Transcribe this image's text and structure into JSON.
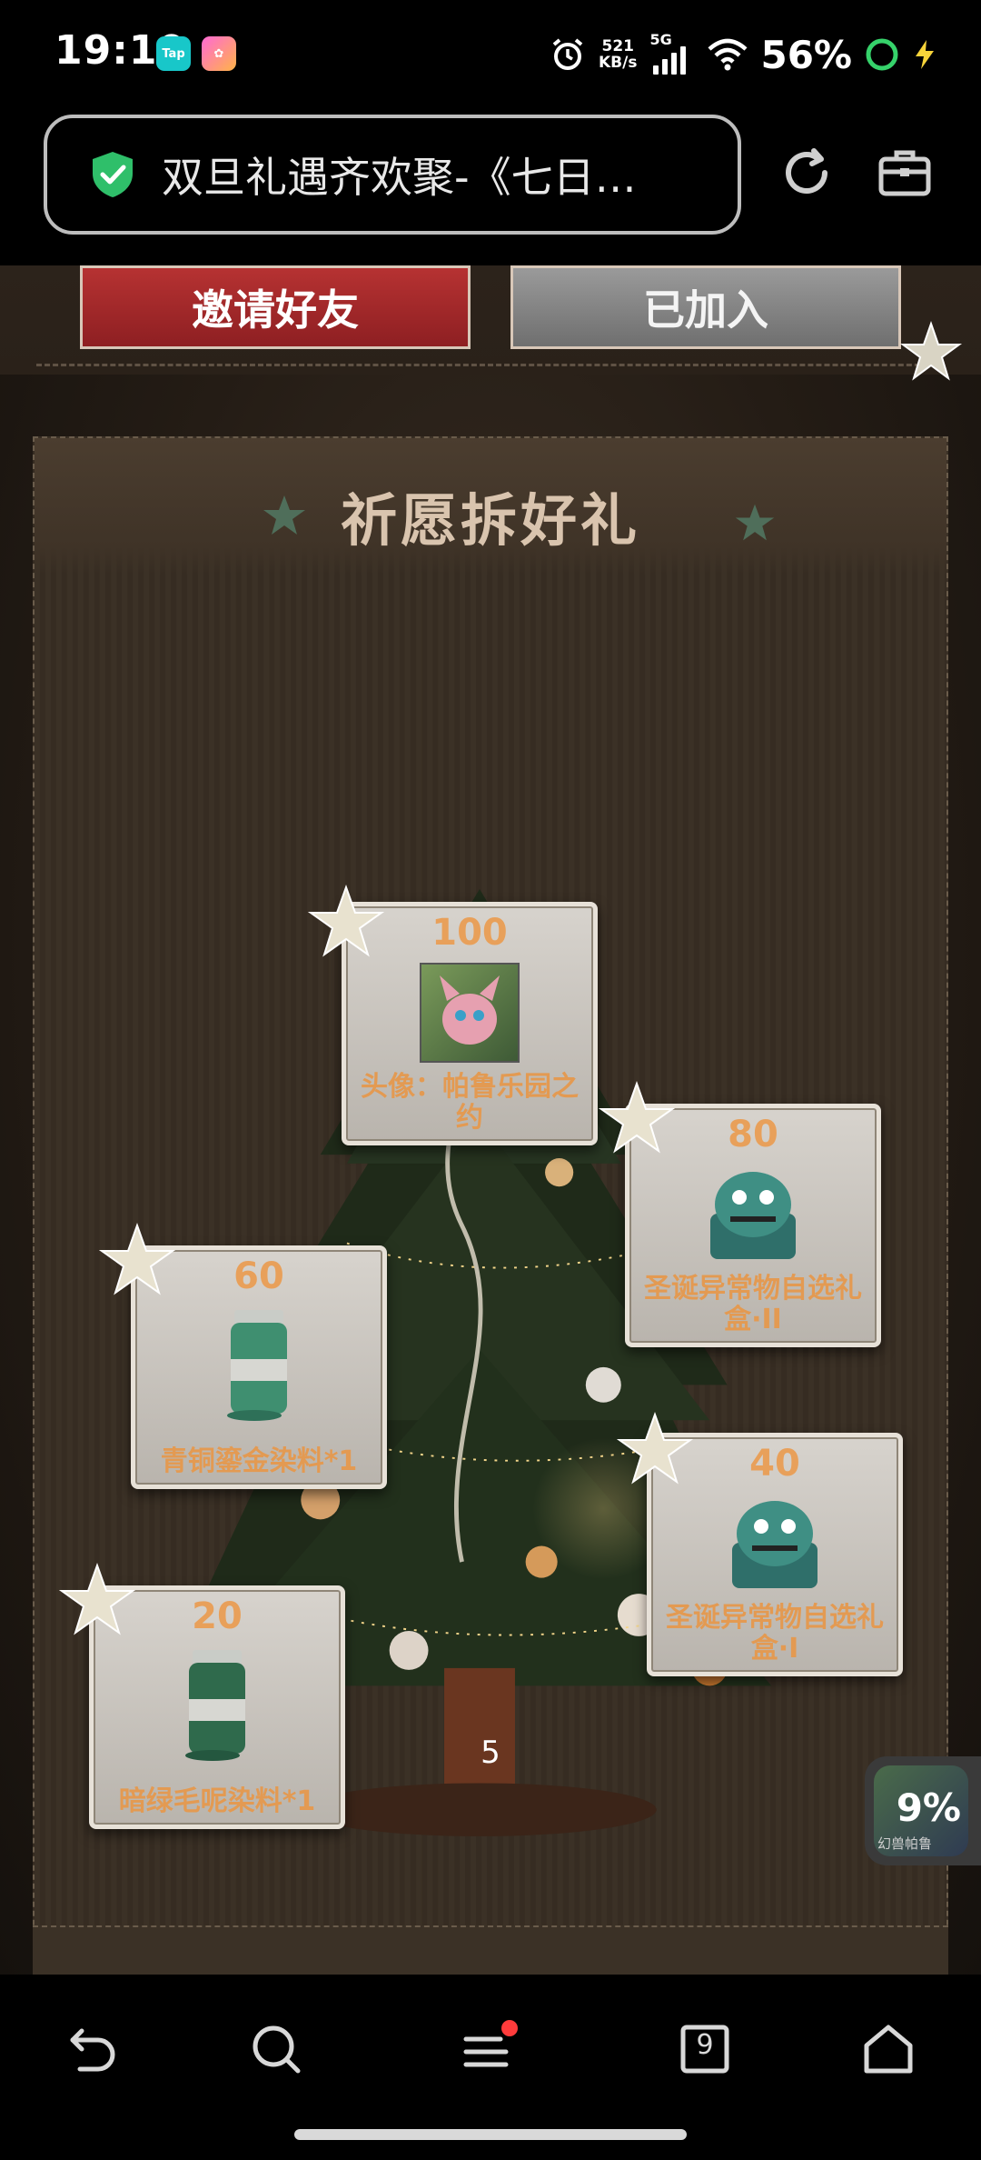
{
  "status_bar": {
    "time": "19:10",
    "badges": [
      "Tap",
      ""
    ],
    "net_speed_value": "521",
    "net_speed_unit": "KB/s",
    "signal_label": "5G",
    "battery_percent": "56%",
    "icons": [
      "alarm-icon",
      "signal-icon",
      "wifi-icon",
      "battery-ring-icon",
      "charging-bolt-icon"
    ]
  },
  "browser": {
    "title": "双旦礼遇齐欢聚-《七日…",
    "secure_icon": "shield-check-icon",
    "refresh_icon": "refresh-icon",
    "toolbox_icon": "toolbox-icon"
  },
  "page": {
    "invite_button": "邀请好友",
    "joined_button": "已加入",
    "section_title": "祈愿拆好礼",
    "rewards": [
      {
        "value": "100",
        "label": "头像：帕鲁乐园之约"
      },
      {
        "value": "80",
        "label": "圣诞异常物自选礼盒·II"
      },
      {
        "value": "60",
        "label": "青铜鎏金染料*1"
      },
      {
        "value": "40",
        "label": "圣诞异常物自选礼盒·I"
      },
      {
        "value": "20",
        "label": "暗绿毛呢染料*1"
      }
    ],
    "current_count": "5",
    "float_widget": {
      "percent": "9%",
      "caption": "幻兽帕鲁"
    }
  },
  "colors": {
    "accent_orange": "#e8a05a",
    "invite_red": "#b63232",
    "joined_gray": "#8a8a8a",
    "panel_bg": "#3b3126"
  },
  "bottom_nav": {
    "tab_count": "9",
    "icons": [
      "back-icon",
      "search-icon",
      "menu-icon",
      "tabs-icon",
      "home-icon"
    ]
  }
}
